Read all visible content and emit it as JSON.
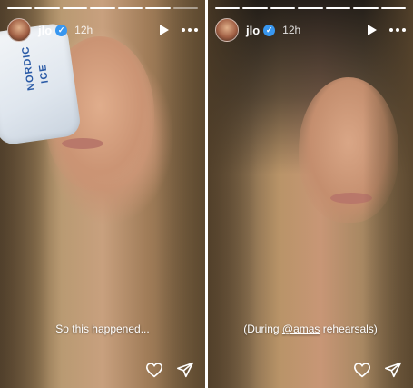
{
  "stories": [
    {
      "username": "jlo",
      "time": "12h",
      "caption": "So this happened...",
      "caption_mention": "",
      "caption_after": "",
      "ice_pack_text": [
        "NORDIC",
        "ICE"
      ],
      "progress_total": 7,
      "progress_done": 6
    },
    {
      "username": "jlo",
      "time": "12h",
      "caption": "(During ",
      "caption_mention": "@amas",
      "caption_after": " rehearsals)",
      "progress_total": 7,
      "progress_done": 7
    }
  ],
  "icons": {
    "verified": "verified-badge-icon",
    "play": "play-icon",
    "more": "more-options-icon",
    "like": "heart-icon",
    "share": "send-icon"
  },
  "colors": {
    "verified_blue": "#3897f0",
    "overlay_text": "#ffffff"
  }
}
